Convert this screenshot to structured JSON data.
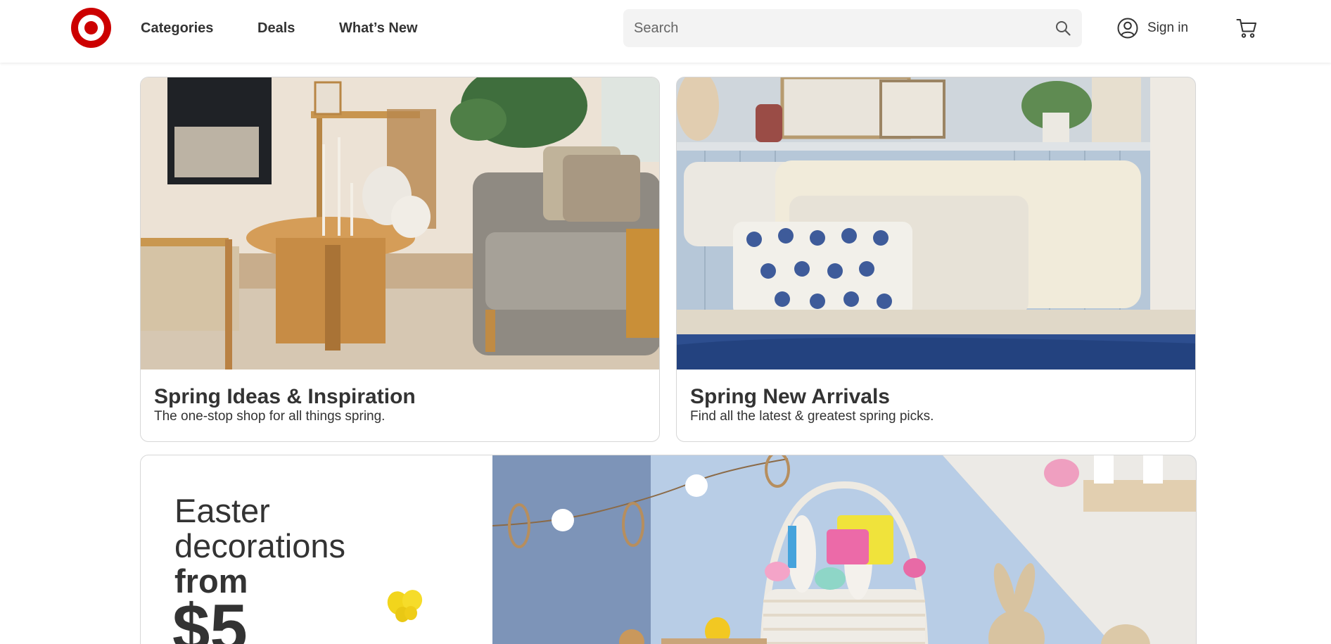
{
  "header": {
    "logo_icon": "target-bullseye-logo",
    "brand_color": "#cc0000",
    "nav": [
      {
        "label": "Categories"
      },
      {
        "label": "Deals"
      },
      {
        "label": "What’s New"
      }
    ],
    "search": {
      "placeholder": "Search",
      "value": "",
      "icon": "search-icon"
    },
    "signin": {
      "label": "Sign in",
      "icon": "account-icon"
    },
    "cart": {
      "icon": "cart-icon"
    }
  },
  "cards": [
    {
      "title": "Spring Ideas & Inspiration",
      "subtitle": "The one-stop shop for all things spring."
    },
    {
      "title": "Spring New Arrivals",
      "subtitle": "Find all the latest & greatest spring picks."
    }
  ],
  "promo": {
    "line1": "Easter",
    "line2": "decorations",
    "line3": "from",
    "price": "$5"
  }
}
